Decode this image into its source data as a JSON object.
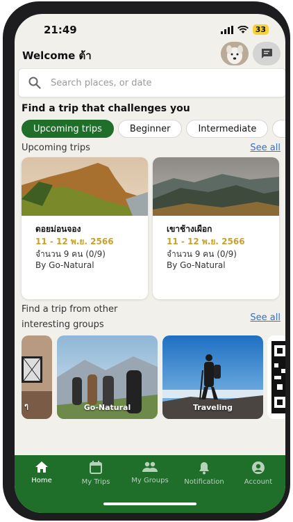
{
  "status_bar": {
    "time": "21:49",
    "battery": "33"
  },
  "header": {
    "welcome": "Welcome ต้า"
  },
  "search": {
    "placeholder": "Search places, or date"
  },
  "challenge": {
    "title": "Find a trip that challenges you",
    "chips": [
      "Upcoming trips",
      "Beginner",
      "Intermediate"
    ]
  },
  "upcoming": {
    "label": "Upcoming trips",
    "see_all": "See all",
    "trips": [
      {
        "name": "ดอยม่อนจอง",
        "date": "11 - 12 พ.ย. 2566",
        "count": "จำนวน 9 คน (0/9)",
        "by": "By Go-Natural"
      },
      {
        "name": "เขาช้างเผือก",
        "date": "11 - 12 พ.ย. 2566",
        "count": "จำนวน 9 คน (0/9)",
        "by": "By Go-Natural"
      }
    ]
  },
  "groups": {
    "label_line1": "Find a trip from other",
    "label_line2": "interesting groups",
    "see_all": "See all",
    "items": [
      {
        "name": "ๆ"
      },
      {
        "name": "Go-Natural"
      },
      {
        "name": "Traveling"
      }
    ]
  },
  "tabbar": {
    "items": [
      {
        "label": "Home",
        "icon": "home-icon"
      },
      {
        "label": "My Trips",
        "icon": "calendar-icon"
      },
      {
        "label": "My Groups",
        "icon": "groups-icon"
      },
      {
        "label": "Notification",
        "icon": "bell-icon"
      },
      {
        "label": "Account",
        "icon": "account-icon"
      }
    ]
  },
  "colors": {
    "primary": "#1f6e2a",
    "link": "#3a6fc4",
    "date": "#c7a12a",
    "background": "#f2f0ea"
  }
}
